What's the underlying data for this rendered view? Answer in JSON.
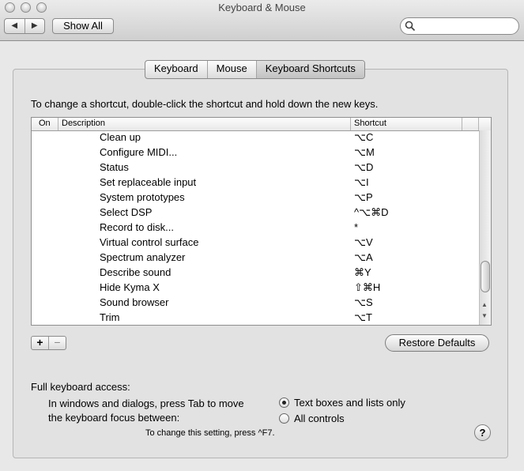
{
  "window": {
    "title": "Keyboard & Mouse"
  },
  "toolbar": {
    "back": "◀",
    "forward": "▶",
    "show_all": "Show All",
    "search_placeholder": ""
  },
  "tabs": [
    {
      "label": "Keyboard"
    },
    {
      "label": "Mouse"
    },
    {
      "label": "Keyboard Shortcuts"
    }
  ],
  "instructions": "To change a shortcut, double-click the shortcut and hold down the new keys.",
  "table": {
    "headers": {
      "on": "On",
      "description": "Description",
      "shortcut": "Shortcut"
    },
    "rows": [
      {
        "description": "Clean up",
        "shortcut": "⌥C"
      },
      {
        "description": "Configure MIDI...",
        "shortcut": "⌥M"
      },
      {
        "description": "Status",
        "shortcut": "⌥D"
      },
      {
        "description": "Set replaceable input",
        "shortcut": "⌥I"
      },
      {
        "description": "System prototypes",
        "shortcut": "⌥P"
      },
      {
        "description": "Select DSP",
        "shortcut": "^⌥⌘D"
      },
      {
        "description": "Record to disk...",
        "shortcut": "*"
      },
      {
        "description": "Virtual control surface",
        "shortcut": "⌥V"
      },
      {
        "description": "Spectrum analyzer",
        "shortcut": "⌥A"
      },
      {
        "description": "Describe sound",
        "shortcut": "⌘Y"
      },
      {
        "description": "Hide Kyma X",
        "shortcut": "⇧⌘H"
      },
      {
        "description": "Sound browser",
        "shortcut": "⌥S"
      },
      {
        "description": "Trim",
        "shortcut": "⌥T"
      }
    ]
  },
  "buttons": {
    "add": "+",
    "remove": "−",
    "restore_defaults": "Restore Defaults",
    "help": "?"
  },
  "keyboard_access": {
    "heading": "Full keyboard access:",
    "description_line1": "In windows and dialogs, press Tab to move",
    "description_line2": "the keyboard focus between:",
    "options": [
      {
        "label": "Text boxes and lists only",
        "selected": true
      },
      {
        "label": "All controls",
        "selected": false
      }
    ],
    "note": "To change this setting, press ^F7."
  }
}
